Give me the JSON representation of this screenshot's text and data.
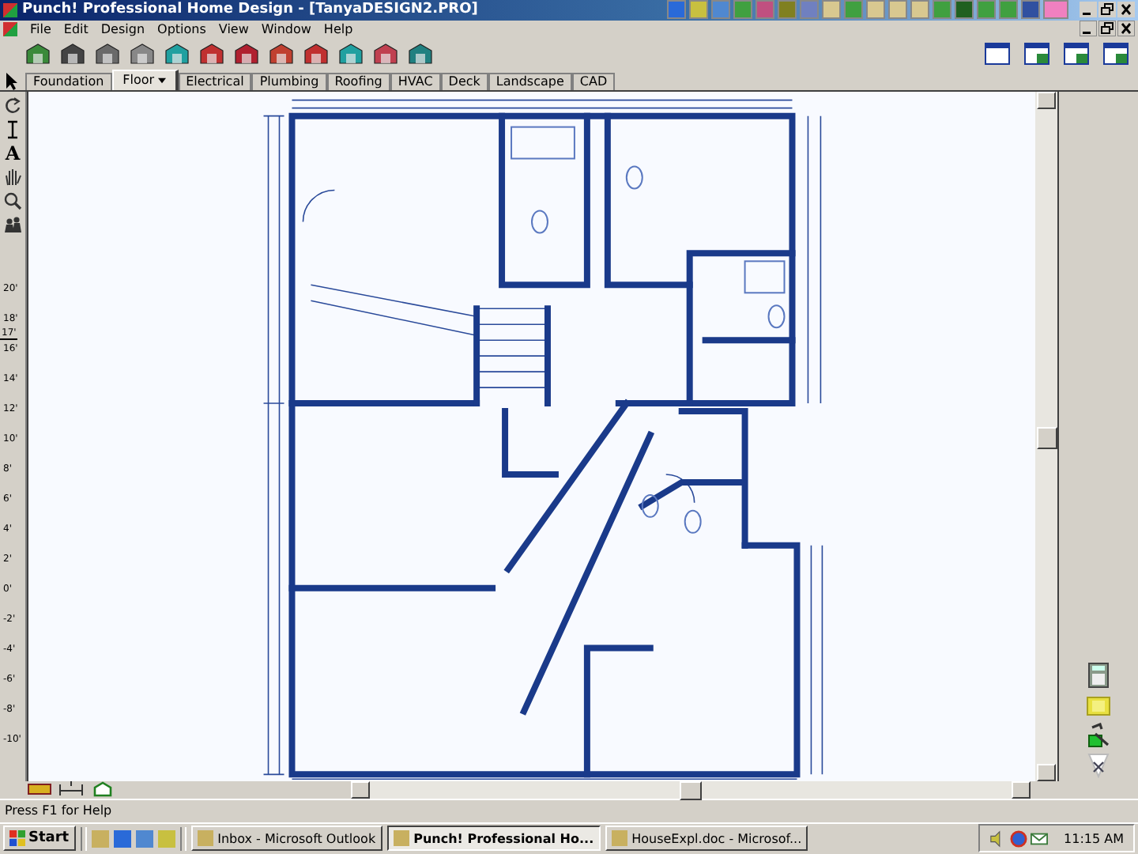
{
  "window": {
    "title": "Punch! Professional Home Design - [TanyaDESIGN2.PRO]"
  },
  "menu": [
    "File",
    "Edit",
    "Design",
    "Options",
    "View",
    "Window",
    "Help"
  ],
  "tabs": [
    {
      "label": "Foundation",
      "selected": false,
      "dropdown": false
    },
    {
      "label": "Floor",
      "selected": true,
      "dropdown": true
    },
    {
      "label": "Electrical",
      "selected": false,
      "dropdown": false
    },
    {
      "label": "Plumbing",
      "selected": false,
      "dropdown": false
    },
    {
      "label": "Roofing",
      "selected": false,
      "dropdown": false
    },
    {
      "label": "HVAC",
      "selected": false,
      "dropdown": false
    },
    {
      "label": "Deck",
      "selected": false,
      "dropdown": false
    },
    {
      "label": "Landscape",
      "selected": false,
      "dropdown": false
    },
    {
      "label": "CAD",
      "selected": false,
      "dropdown": false
    }
  ],
  "tools": {
    "text_tool": "A"
  },
  "ruler": {
    "labels": [
      "20'",
      "18'",
      "16'",
      "14'",
      "12'",
      "10'",
      "8'",
      "6'",
      "4'",
      "2'",
      "0'",
      "-2'",
      "-4'",
      "-6'",
      "-8'",
      "-10'"
    ],
    "marker": "17'"
  },
  "status_bar": "Press F1 for Help",
  "taskbar": {
    "start": "Start",
    "tasks": [
      {
        "label": "Inbox - Microsoft Outlook",
        "selected": false
      },
      {
        "label": "Punch! Professional Ho...",
        "selected": true
      },
      {
        "label": "HouseExpl.doc - Microsof...",
        "selected": false
      }
    ],
    "clock": "11:15 AM"
  }
}
